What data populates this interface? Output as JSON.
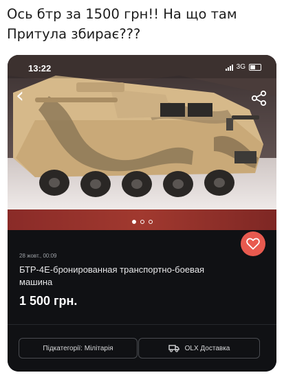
{
  "caption": "Ось бтр за 1500 грн!! На що там Притула збирає???",
  "status_bar": {
    "time": "13:22",
    "network": "3G"
  },
  "gallery": {
    "slide_count": 3,
    "active_slide": 1
  },
  "listing": {
    "date": "28 жовт., 00:09",
    "title": "БТР-4Е-бронированная транспортно-боевая машина",
    "price": "1 500 грн."
  },
  "chips": {
    "subcategory": "Підкатегорії: Мілітарія",
    "delivery": "OLX Доставка"
  },
  "colors": {
    "favorite": "#e85a4f",
    "background": "#101114"
  },
  "icons": [
    "back-arrow-icon",
    "share-icon",
    "heart-icon",
    "delivery-truck-icon",
    "signal-icon",
    "battery-icon"
  ]
}
